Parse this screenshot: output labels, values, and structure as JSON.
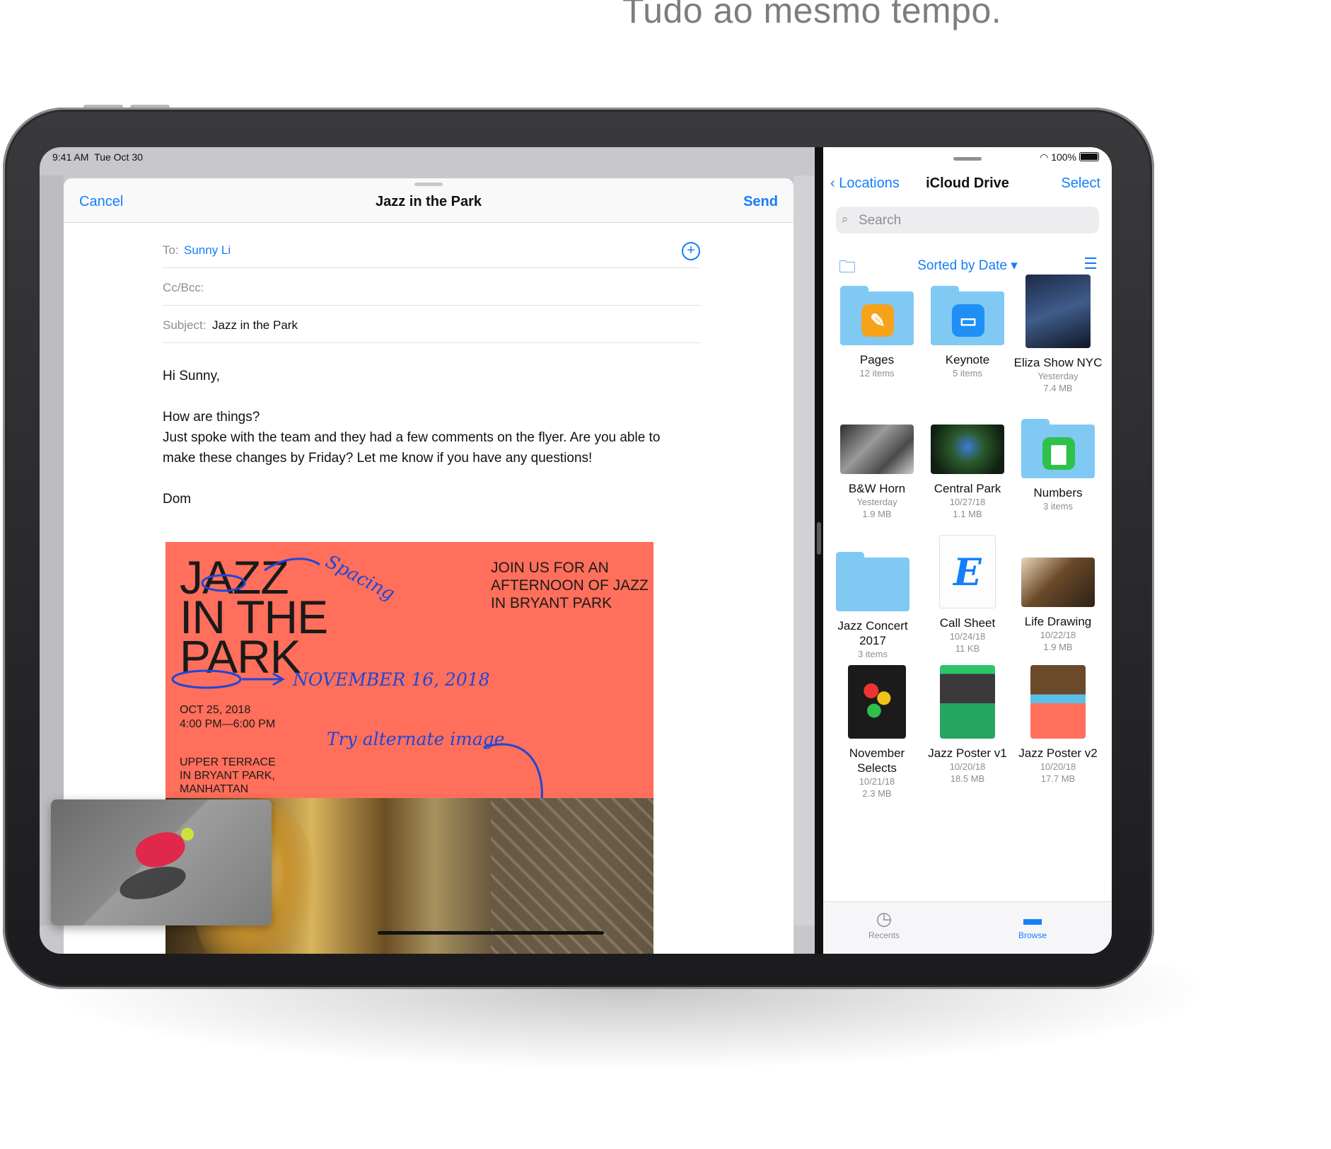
{
  "headline": "Tudo ao mesmo tempo.",
  "status_bar": {
    "time": "9:41 AM",
    "date": "Tue Oct 30",
    "battery": "100%"
  },
  "compose": {
    "cancel": "Cancel",
    "title": "Jazz in the Park",
    "send": "Send",
    "to_label": "To:",
    "to_value": "Sunny Li",
    "cc_label": "Cc/Bcc:",
    "subject_label": "Subject:",
    "subject_value": "Jazz in the Park",
    "body": {
      "greeting": "Hi Sunny,",
      "line1": "How are things?",
      "line2": "Just spoke with the team and they had a few comments on the flyer. Are you able to",
      "line3": "make these changes by Friday? Let me know if you have any questions!",
      "signoff": "Dom"
    }
  },
  "flyer": {
    "title_line1": "JAZZ",
    "title_line2": "IN THE",
    "title_line3": "PARK",
    "join_line1": "JOIN US FOR AN",
    "join_line2": "AFTERNOON OF JAZZ",
    "join_line3": "IN BRYANT PARK",
    "date": "OCT 25, 2018",
    "time": "4:00 PM—6:00 PM",
    "venue_line1": "UPPER TERRACE",
    "venue_line2": "IN BRYANT PARK,",
    "venue_line3": "MANHATTAN",
    "note_spacing": "Spacing",
    "note_date": "NOVEMBER 16, 2018",
    "note_image": "Try alternate image"
  },
  "files": {
    "back_label": "Locations",
    "title": "iCloud Drive",
    "select": "Select",
    "search_placeholder": "Search",
    "sort_label": "Sorted by Date",
    "items": [
      {
        "name": "Pages",
        "meta1": "12 items",
        "meta2": "",
        "kind": "folder",
        "icon": "pages-icon",
        "color": "#f7a21b"
      },
      {
        "name": "Keynote",
        "meta1": "5 items",
        "meta2": "",
        "kind": "folder",
        "icon": "keynote-icon",
        "color": "#1f8ff5"
      },
      {
        "name": "Eliza Show NYC",
        "meta1": "Yesterday",
        "meta2": "7.4 MB",
        "kind": "portrait",
        "icon": "photo-thumbnail"
      },
      {
        "name": "B&W Horn",
        "meta1": "Yesterday",
        "meta2": "1.9 MB",
        "kind": "photo",
        "icon": "photo-thumbnail"
      },
      {
        "name": "Central Park",
        "meta1": "10/27/18",
        "meta2": "1.1 MB",
        "kind": "photo",
        "icon": "photo-thumbnail"
      },
      {
        "name": "Numbers",
        "meta1": "3 items",
        "meta2": "",
        "kind": "folder",
        "icon": "numbers-icon",
        "color": "#2fc14a"
      },
      {
        "name": "Jazz Concert 2017",
        "meta1": "3 items",
        "meta2": "",
        "kind": "folder",
        "icon": "folder-icon"
      },
      {
        "name": "Call Sheet",
        "meta1": "10/24/18",
        "meta2": "11 KB",
        "kind": "doc",
        "icon": "document-icon",
        "letter": "E"
      },
      {
        "name": "Life Drawing",
        "meta1": "10/22/18",
        "meta2": "1.9 MB",
        "kind": "photo",
        "icon": "photo-thumbnail"
      },
      {
        "name": "November Selects",
        "meta1": "10/21/18",
        "meta2": "2.3 MB",
        "kind": "portrait",
        "icon": "photo-thumbnail"
      },
      {
        "name": "Jazz Poster v1",
        "meta1": "10/20/18",
        "meta2": "18.5 MB",
        "kind": "portrait",
        "icon": "poster-thumbnail"
      },
      {
        "name": "Jazz Poster v2",
        "meta1": "10/20/18",
        "meta2": "17.7 MB",
        "kind": "portrait",
        "icon": "poster-thumbnail"
      }
    ],
    "tabs": [
      {
        "label": "Recents",
        "icon": "clock-icon",
        "active": false
      },
      {
        "label": "Browse",
        "icon": "folder-icon",
        "active": true
      }
    ]
  },
  "colors": {
    "accent": "#147efb",
    "flyer": "#ff6f5b",
    "annotation": "#1f47d8"
  }
}
